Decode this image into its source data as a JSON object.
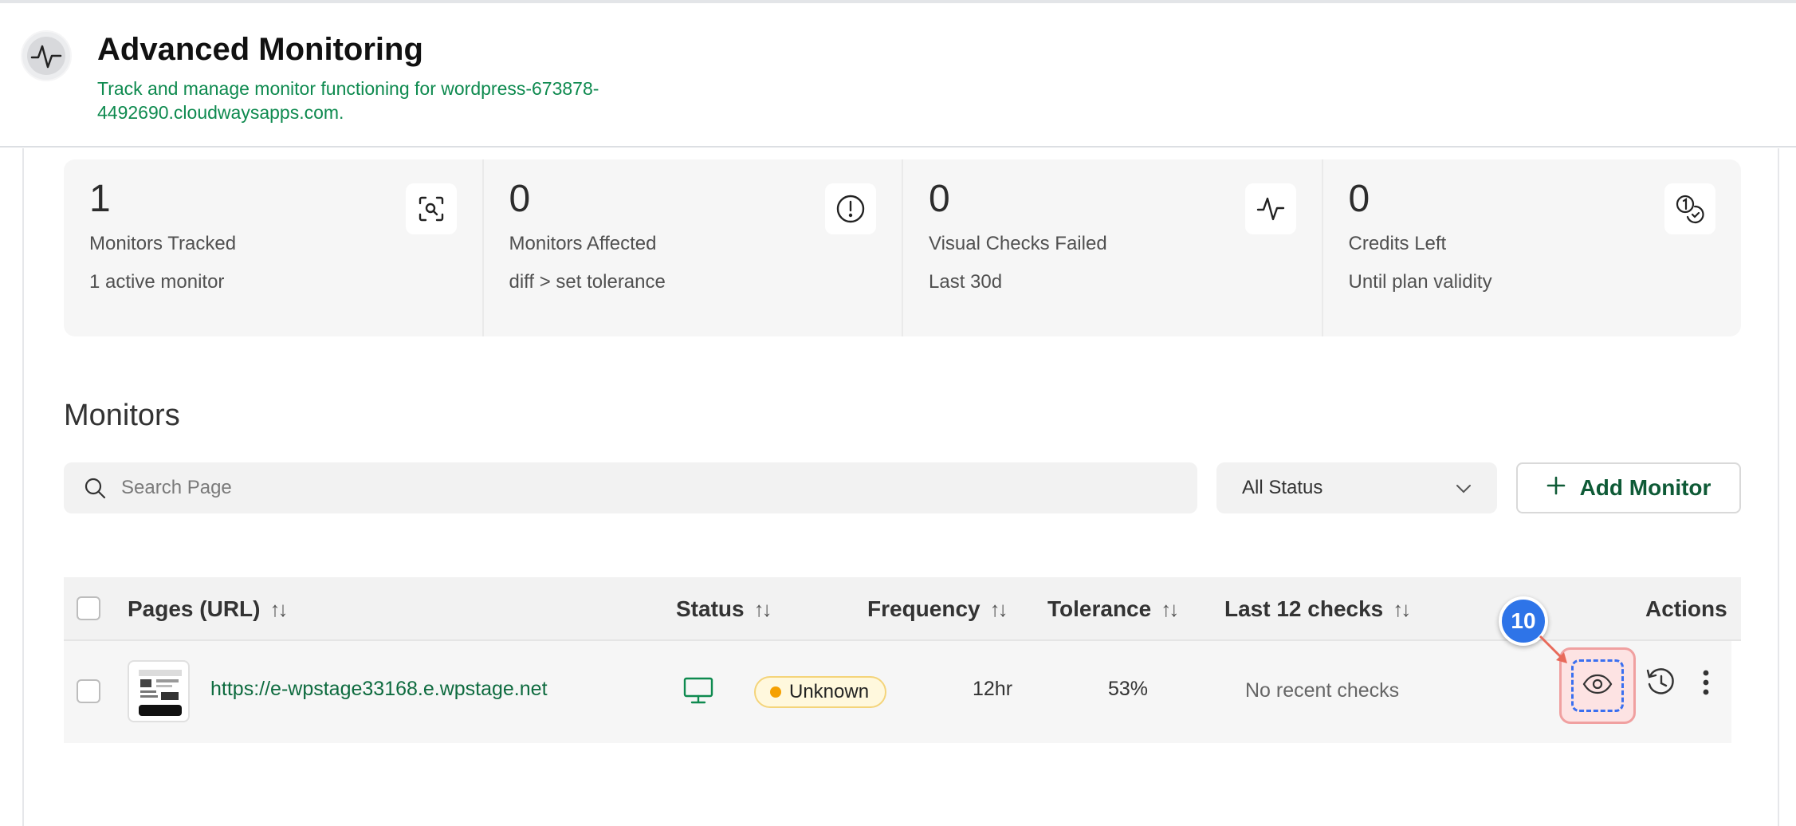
{
  "header": {
    "title": "Advanced Monitoring",
    "subtitle": "Track and manage monitor functioning for wordpress-673878-4492690.cloudwaysapps.com."
  },
  "stats": [
    {
      "value": "1",
      "label": "Monitors Tracked",
      "sub": "1 active monitor",
      "icon": "search-scan-icon"
    },
    {
      "value": "0",
      "label": "Monitors Affected",
      "sub": "diff > set tolerance",
      "icon": "alert-circle-icon"
    },
    {
      "value": "0",
      "label": "Visual Checks Failed",
      "sub": "Last 30d",
      "icon": "pulse-icon"
    },
    {
      "value": "0",
      "label": "Credits Left",
      "sub": "Until plan validity",
      "icon": "credits-icon"
    }
  ],
  "monitors": {
    "title": "Monitors",
    "search_placeholder": "Search Page",
    "status_filter": "All Status",
    "add_label": "Add Monitor"
  },
  "table": {
    "headers": {
      "pages": "Pages (URL)",
      "status": "Status",
      "frequency": "Frequency",
      "tolerance": "Tolerance",
      "last_checks": "Last 12 checks",
      "actions": "Actions"
    },
    "rows": [
      {
        "url": "https://e-wpstage33168.e.wpstage.net",
        "status": "Unknown",
        "frequency": "12hr",
        "tolerance": "53%",
        "last_checks": "No recent checks"
      }
    ]
  },
  "annotation": {
    "step": "10"
  },
  "colors": {
    "accent_green": "#0e8a4f",
    "status_unknown": "#f5a000",
    "step_blue": "#2e74e8"
  }
}
